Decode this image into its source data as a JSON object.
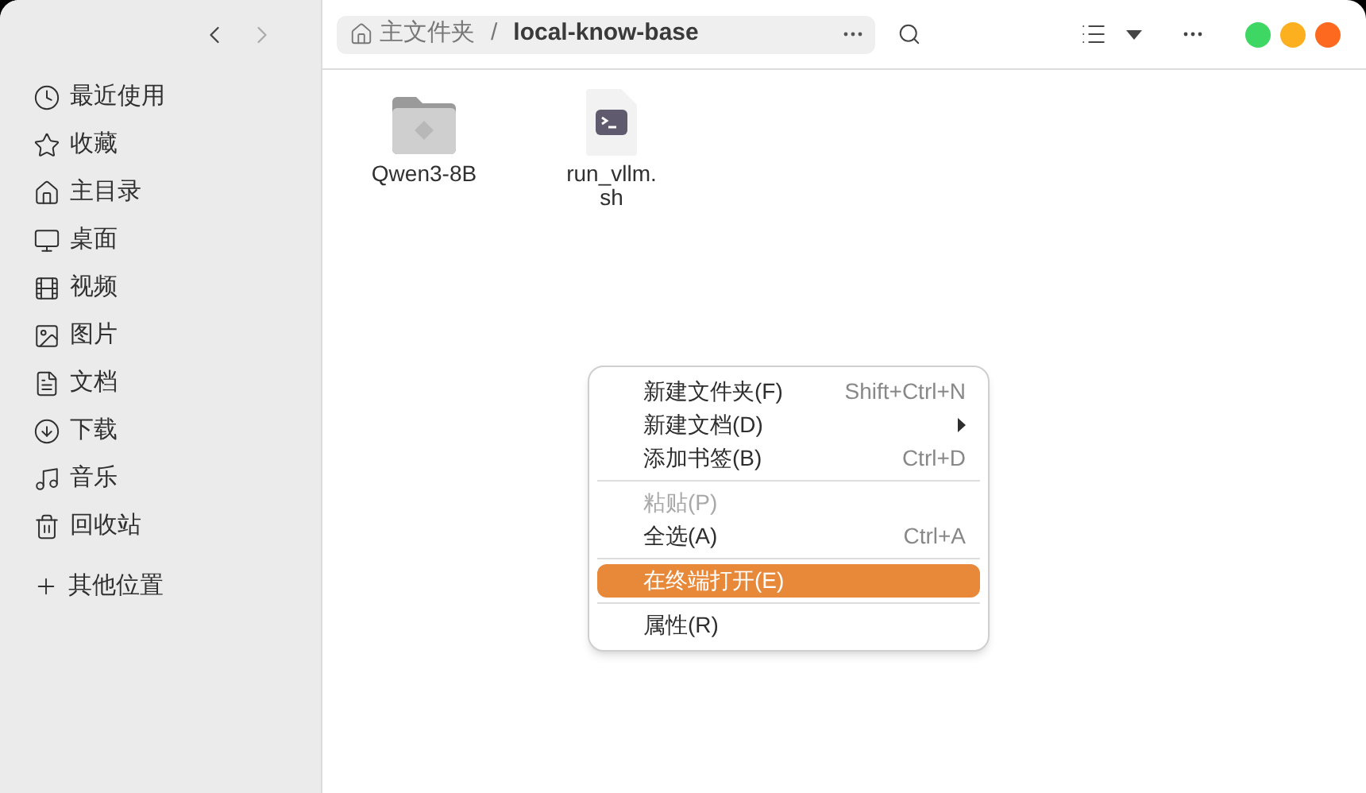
{
  "sidebar": {
    "items": [
      {
        "label": "最近使用"
      },
      {
        "label": "收藏"
      },
      {
        "label": "主目录"
      },
      {
        "label": "桌面"
      },
      {
        "label": "视频"
      },
      {
        "label": "图片"
      },
      {
        "label": "文档"
      },
      {
        "label": "下载"
      },
      {
        "label": "音乐"
      },
      {
        "label": "回收站"
      }
    ],
    "other": {
      "label": "其他位置"
    }
  },
  "path": [
    {
      "label": "主文件夹",
      "kind": "home"
    },
    {
      "label": "local-know-base",
      "kind": "current",
      "separator": "/"
    }
  ],
  "files": [
    {
      "name": "Qwen3-8B",
      "kind": "folder"
    },
    {
      "name": "run_vllm.\nsh",
      "kind": "script"
    }
  ],
  "context_menu": [
    [
      {
        "label": "新建文件夹(F)",
        "shortcut": "Shift+Ctrl+N",
        "submenu": false,
        "disabled": false,
        "selected": false
      },
      {
        "label": "新建文档(D)",
        "submenu": true,
        "disabled": false,
        "selected": false
      },
      {
        "label": "添加书签(B)",
        "shortcut": "Ctrl+D",
        "submenu": false,
        "disabled": false,
        "selected": false
      }
    ],
    [
      {
        "label": "粘贴(P)",
        "submenu": false,
        "disabled": true,
        "selected": false
      },
      {
        "label": "全选(A)",
        "shortcut": "Ctrl+A",
        "submenu": false,
        "disabled": false,
        "selected": false
      }
    ],
    [
      {
        "label": "在终端打开(E)",
        "submenu": false,
        "disabled": false,
        "selected": true
      }
    ],
    [
      {
        "label": "属性(R)",
        "submenu": false,
        "disabled": false,
        "selected": false
      }
    ]
  ]
}
